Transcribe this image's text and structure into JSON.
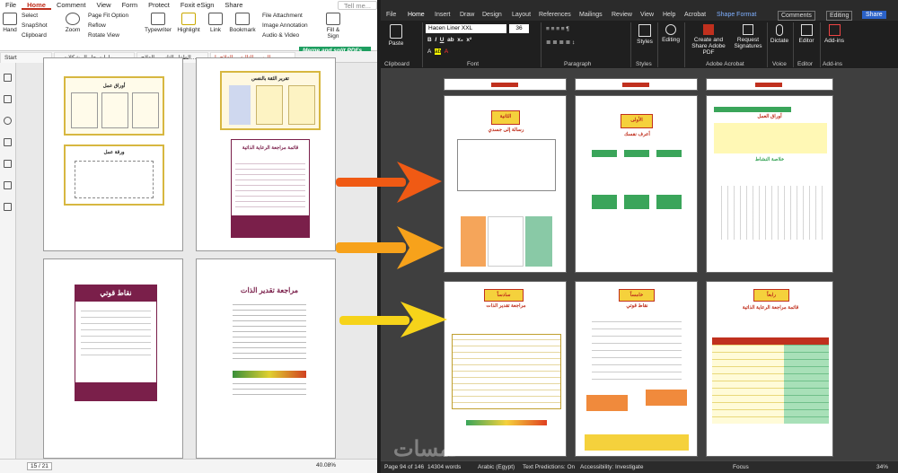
{
  "foxit": {
    "menu": [
      "File",
      "Home",
      "Comment",
      "View",
      "Form",
      "Protect",
      "Foxit eSign",
      "Share"
    ],
    "search_placeholder": "Tell me...",
    "ribbon": {
      "hand": "Hand",
      "select": "Select",
      "snapshot": "SnapShot",
      "clipboard": "Clipboard",
      "zoom": "Zoom",
      "page_fit": "Page Fit Option",
      "reflow": "Reflow",
      "rotate": "Rotate View",
      "typewriter": "Typewriter",
      "highlight": "Highlight",
      "link": "Link",
      "bookmark": "Bookmark",
      "file_attachment": "File Attachment",
      "image_annotation": "Image Annotation",
      "audio_video": "Audio & Video",
      "fill_sign": "Fill & Sign"
    },
    "banner": "Merge and split PDFs",
    "tabs": [
      "Start",
      "مهارات حل المشكلات و...",
      "الطفل الثاني و العلاج...",
      "الرسم الثالث و العلاج با..."
    ],
    "pages": [
      {
        "title": "أوراق عمل",
        "caption": "ورقة عمل"
      },
      {
        "title": "تقرير الثقة بالنفس",
        "caption": ""
      },
      {
        "title": "قائمة مراجعة الرعاية الذاتية",
        "caption": ""
      },
      {
        "title": "نقاط قوتي",
        "caption": ""
      },
      {
        "title": "مراجعة تقدير الذات",
        "caption": ""
      }
    ],
    "status": {
      "page": "15 / 21",
      "zoom": "40.08%"
    }
  },
  "word": {
    "menu": [
      "File",
      "Home",
      "Insert",
      "Draw",
      "Design",
      "Layout",
      "References",
      "Mailings",
      "Review",
      "View",
      "Help",
      "Acrobat",
      "Shape Format"
    ],
    "comments": "Comments",
    "editing": "Editing",
    "share": "Share",
    "font": "Hacen Liner XXL",
    "size": "36",
    "groups": {
      "clipboard": "Clipboard",
      "font": "Font",
      "paragraph": "Paragraph",
      "styles": "Styles",
      "acrobat": "Adobe Acrobat",
      "voice": "Voice",
      "editor": "Editor",
      "addins": "Add-ins"
    },
    "buttons": {
      "paste": "Paste",
      "styles": "Styles",
      "editing": "Editing",
      "create_share": "Create and Share Adobe PDF",
      "request_sig": "Request Signatures",
      "dictate": "Dictate",
      "editor": "Editor",
      "addins": "Add-ins"
    },
    "pages": [
      {
        "title": "الثانية",
        "subtitle": "رسالة إلى جسدي"
      },
      {
        "title": "الأولى",
        "subtitle": "أعرف نفسك"
      },
      {
        "title": "أوراق العمل",
        "subtitle": "خلاصة النشاط"
      },
      {
        "title": "سادساً",
        "subtitle": "مراجعة تقدير الذات"
      },
      {
        "title": "خامساً",
        "subtitle": "نقاط قوتي"
      },
      {
        "title": "رابعاً",
        "subtitle": "قائمة مراجعة الرعاية الذاتية"
      }
    ],
    "status": {
      "page": "Page 94 of 146",
      "words": "14304 words",
      "lang": "Arabic (Egypt)",
      "text_pred": "Text Predictions: On",
      "access": "Accessibility: Investigate",
      "focus": "Focus",
      "zoom": "34%"
    }
  },
  "watermark": "خمسات",
  "colors": {
    "arrow1": "#f05a14",
    "arrow2": "#f7a21b",
    "arrow3": "#f6d31a",
    "foxit_red": "#c0301e",
    "gold": "#d7b740",
    "maroon": "#7a1f4a"
  }
}
